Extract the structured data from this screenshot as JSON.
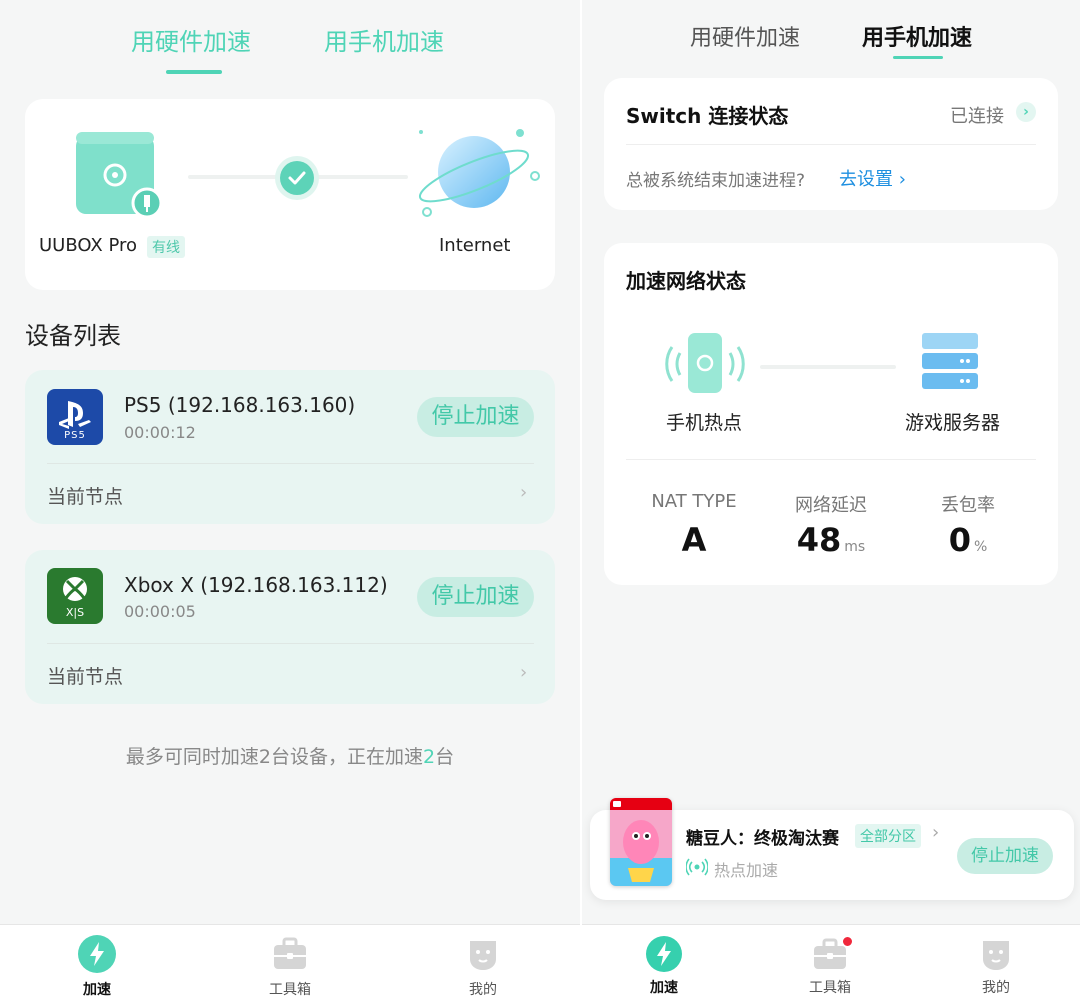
{
  "left": {
    "tabs": [
      {
        "label": "用硬件加速",
        "active": true
      },
      {
        "label": "用手机加速",
        "active": false
      }
    ],
    "connection": {
      "device_name": "UUBOX Pro",
      "device_tag": "有线",
      "target": "Internet"
    },
    "device_list_title": "设备列表",
    "devices": [
      {
        "name": "PS5 (192.168.163.160)",
        "time": "00:00:12",
        "button": "停止加速",
        "node_label": "当前节点",
        "icon": "ps5-icon",
        "icon_text": "PS5"
      },
      {
        "name": "Xbox X (192.168.163.112)",
        "time": "00:00:05",
        "button": "停止加速",
        "node_label": "当前节点",
        "icon": "xbox-icon",
        "icon_text": "X|S"
      }
    ],
    "footer_note_prefix": "最多可同时加速2台设备，正在加速",
    "footer_note_count": "2",
    "footer_note_suffix": "台",
    "nav": [
      {
        "label": "加速",
        "icon": "lightning-icon",
        "active": true
      },
      {
        "label": "工具箱",
        "icon": "toolbox-icon",
        "active": false
      },
      {
        "label": "我的",
        "icon": "profile-face-icon",
        "active": false
      }
    ]
  },
  "right": {
    "tabs": [
      {
        "label": "用硬件加速",
        "active": false
      },
      {
        "label": "用手机加速",
        "active": true
      }
    ],
    "switch_card": {
      "title": "Switch 连接状态",
      "status": "已连接",
      "hint": "总被系统结束加速进程?",
      "hint_link": "去设置"
    },
    "network_card": {
      "title": "加速网络状态",
      "from_label": "手机热点",
      "to_label": "游戏服务器",
      "stats": [
        {
          "label": "NAT TYPE",
          "value": "A",
          "unit": ""
        },
        {
          "label": "网络延迟",
          "value": "48",
          "unit": "ms"
        },
        {
          "label": "丢包率",
          "value": "0",
          "unit": "%"
        }
      ]
    },
    "game_bar": {
      "title": "糖豆人：终极淘汰赛",
      "region_tag": "全部分区",
      "mode": "热点加速",
      "button": "停止加速"
    },
    "nav": [
      {
        "label": "加速",
        "icon": "lightning-icon",
        "active": true
      },
      {
        "label": "工具箱",
        "icon": "toolbox-icon",
        "active": false,
        "badge": true
      },
      {
        "label": "我的",
        "icon": "profile-face-icon",
        "active": false
      }
    ]
  },
  "colors": {
    "accent": "#4fd4b6",
    "mint_bg": "#e8f5f2",
    "button_bg": "#c8ede3",
    "link_blue": "#1e8fe0",
    "badge_red": "#f0283c"
  }
}
